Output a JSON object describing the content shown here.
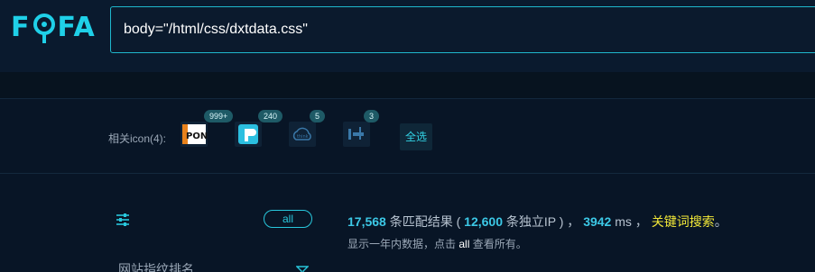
{
  "logo": {
    "text_f": "F",
    "text_fa": "FA",
    "color": "#1fd0e8"
  },
  "search": {
    "value": "body=\"/html/css/dxtdata.css\""
  },
  "related_icons": {
    "label": "相关icon(4):",
    "items": [
      {
        "name": "icon-1",
        "count": "999+"
      },
      {
        "name": "icon-2",
        "count": "240"
      },
      {
        "name": "icon-3",
        "count": "5"
      },
      {
        "name": "icon-4",
        "count": "3"
      }
    ],
    "select_all": "全选"
  },
  "results": {
    "filter_all": "all",
    "count": "17,568",
    "count_label": "条匹配结果 (",
    "ip_count": "12,600",
    "ip_label": "条独立IP ) ，",
    "time": "3942",
    "time_label": "ms ，",
    "keyword_search": "关键词搜索",
    "period": "。",
    "note_prefix": "显示一年内数据，点击",
    "note_link": "all",
    "note_suffix": "查看所有。"
  },
  "sidebar": {
    "title": "网站指纹排名"
  },
  "colors": {
    "accent": "#1fd0e8",
    "keyword": "#f2e838",
    "background": "#081526"
  }
}
